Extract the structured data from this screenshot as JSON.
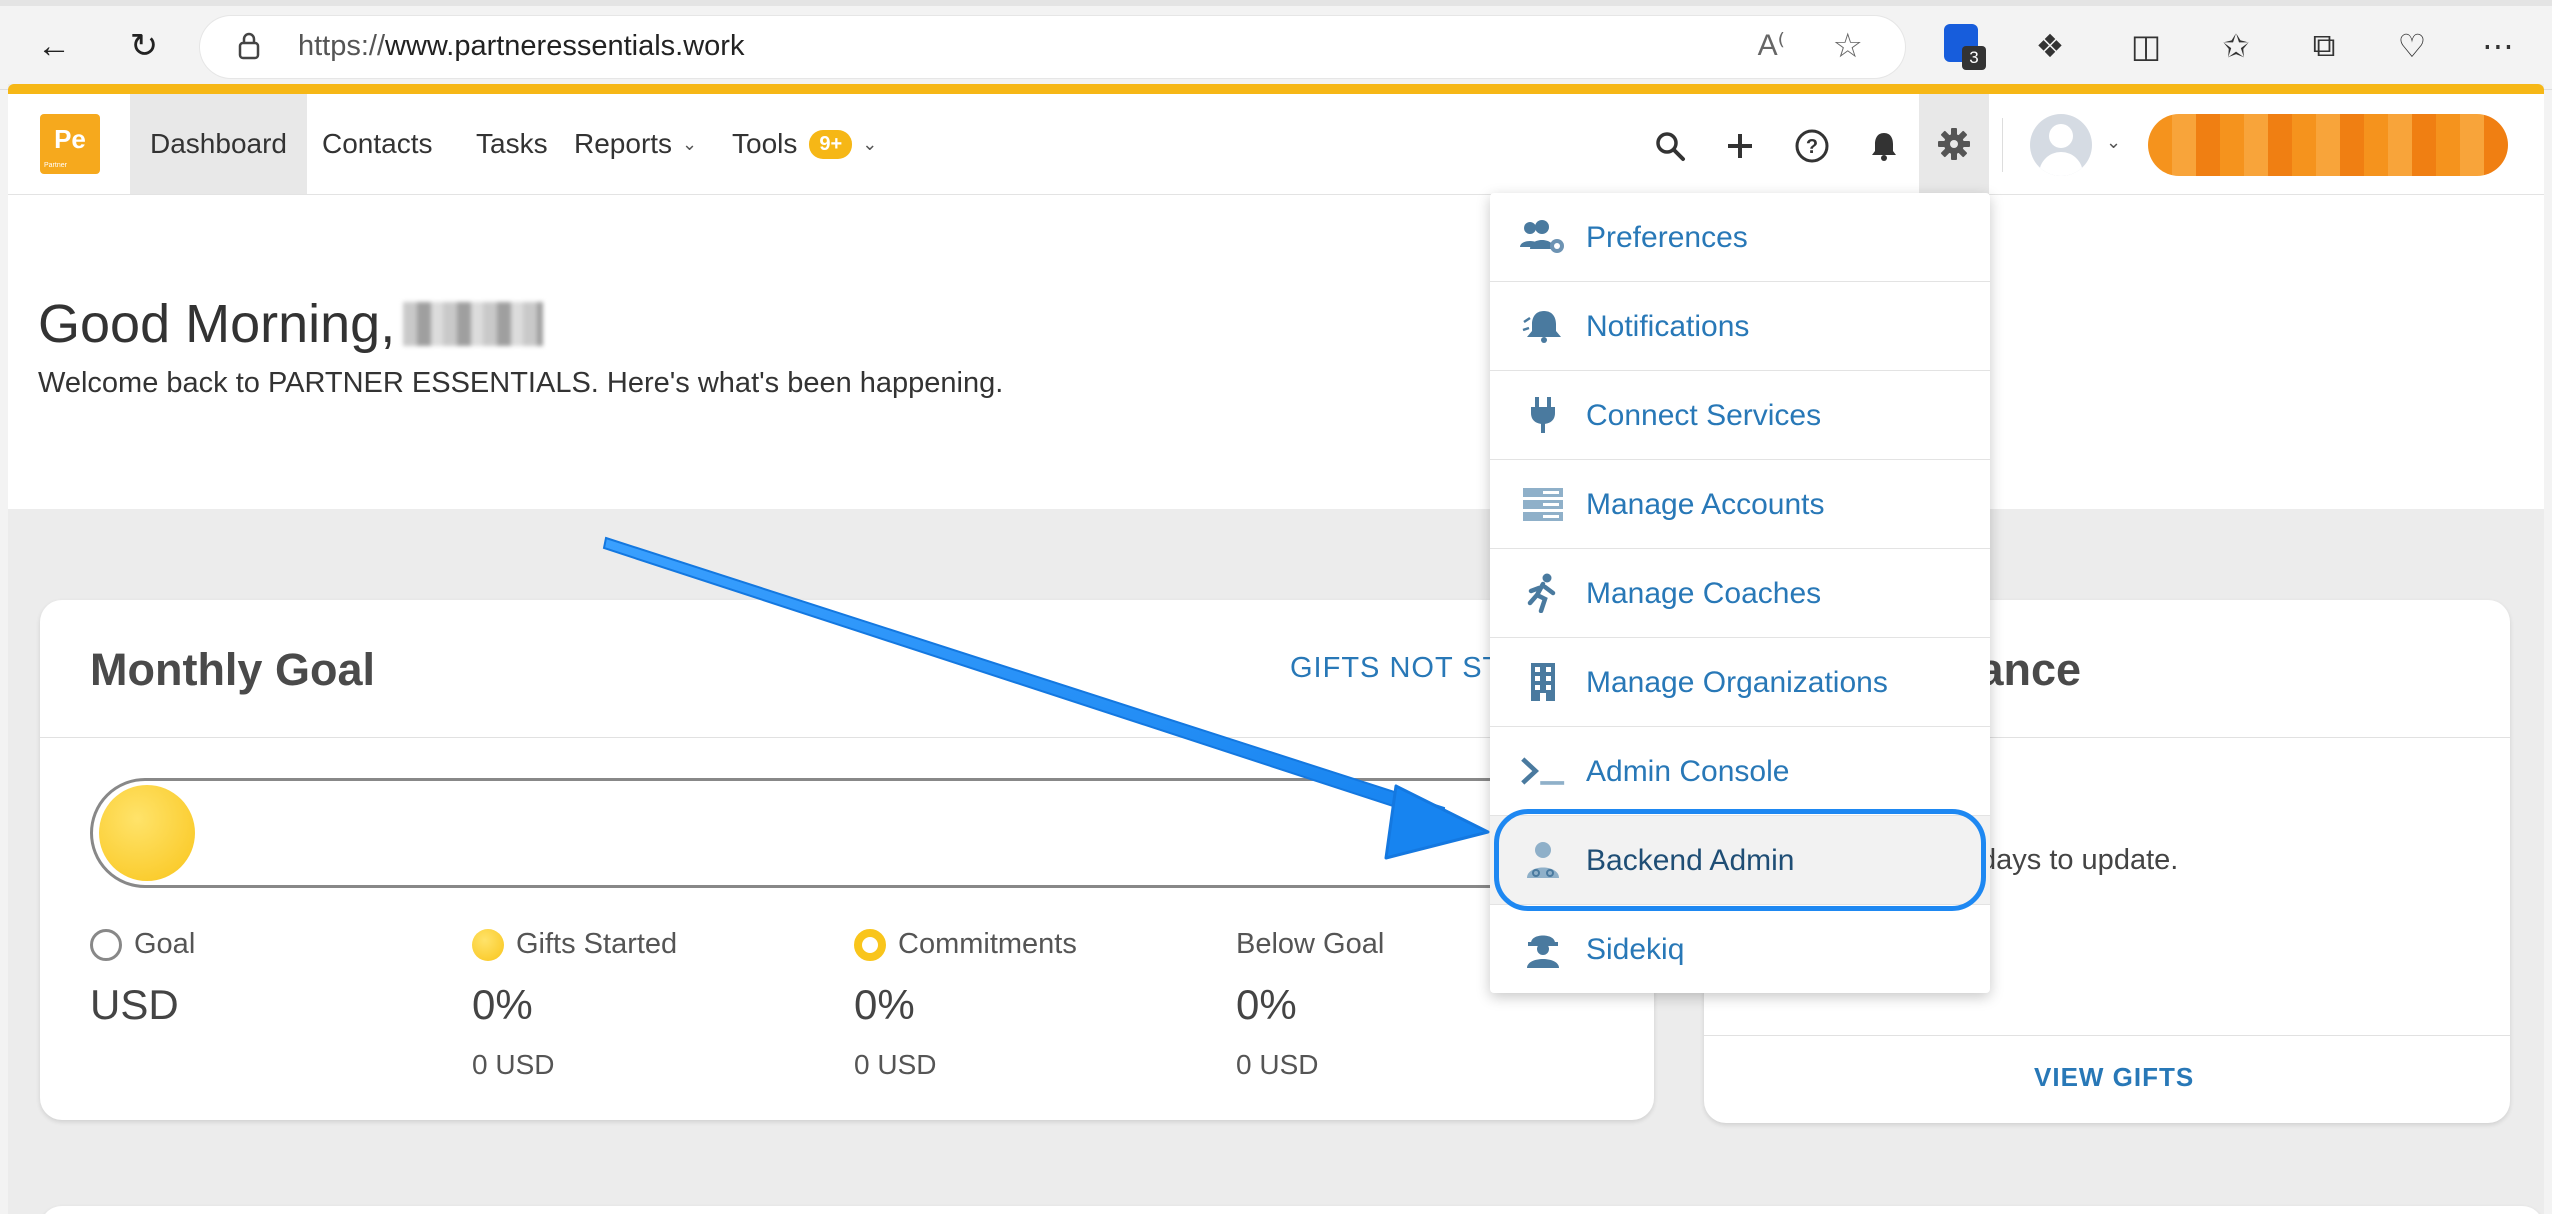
{
  "browser": {
    "url_protocol": "https://",
    "url_host": "www.partneressentials.work",
    "extension_badge": "3",
    "icons": [
      "back-icon",
      "refresh-icon",
      "lock-icon",
      "read-aloud-icon",
      "favorite-star-icon",
      "extension-icon",
      "split-screen-icon",
      "favorites-icon",
      "collections-icon",
      "browser-essentials-icon",
      "more-icon"
    ]
  },
  "app": {
    "logo_text": "Pe",
    "logo_subtext": "Partner",
    "nav": {
      "dashboard": "Dashboard",
      "contacts": "Contacts",
      "tasks": "Tasks",
      "reports": "Reports",
      "tools": "Tools",
      "tools_badge": "9+"
    },
    "accent_color": "#f6b716",
    "link_color": "#2878b7"
  },
  "greeting": {
    "title": "Good Morning,",
    "subtitle": "Welcome back to PARTNER ESSENTIALS. Here's what's been happening."
  },
  "monthly_goal": {
    "title": "Monthly Goal",
    "link": "GIFTS NOT STA",
    "stats": [
      {
        "label": "Goal",
        "value": "USD",
        "amount": ""
      },
      {
        "label": "Gifts Started",
        "value": "0%",
        "amount": "0 USD"
      },
      {
        "label": "Commitments",
        "value": "0%",
        "amount": "0 USD"
      },
      {
        "label": "Below Goal",
        "value": "0%",
        "amount": "0 USD"
      }
    ]
  },
  "balance_card": {
    "title_partial": "lance",
    "text_partial": "days to update.",
    "footer_link": "VIEW GIFTS"
  },
  "settings_menu": {
    "items": [
      {
        "label": "Preferences",
        "icon": "users-cog-icon"
      },
      {
        "label": "Notifications",
        "icon": "bell-icon"
      },
      {
        "label": "Connect Services",
        "icon": "plug-icon"
      },
      {
        "label": "Manage Accounts",
        "icon": "server-icon"
      },
      {
        "label": "Manage Coaches",
        "icon": "running-icon"
      },
      {
        "label": "Manage Organizations",
        "icon": "building-icon"
      },
      {
        "label": "Admin Console",
        "icon": "terminal-icon"
      },
      {
        "label": "Backend Admin",
        "icon": "user-doctor-icon"
      },
      {
        "label": "Sidekiq",
        "icon": "hard-hat-icon"
      }
    ],
    "highlighted": "Backend Admin",
    "highlight_color": "#1e88f2"
  }
}
